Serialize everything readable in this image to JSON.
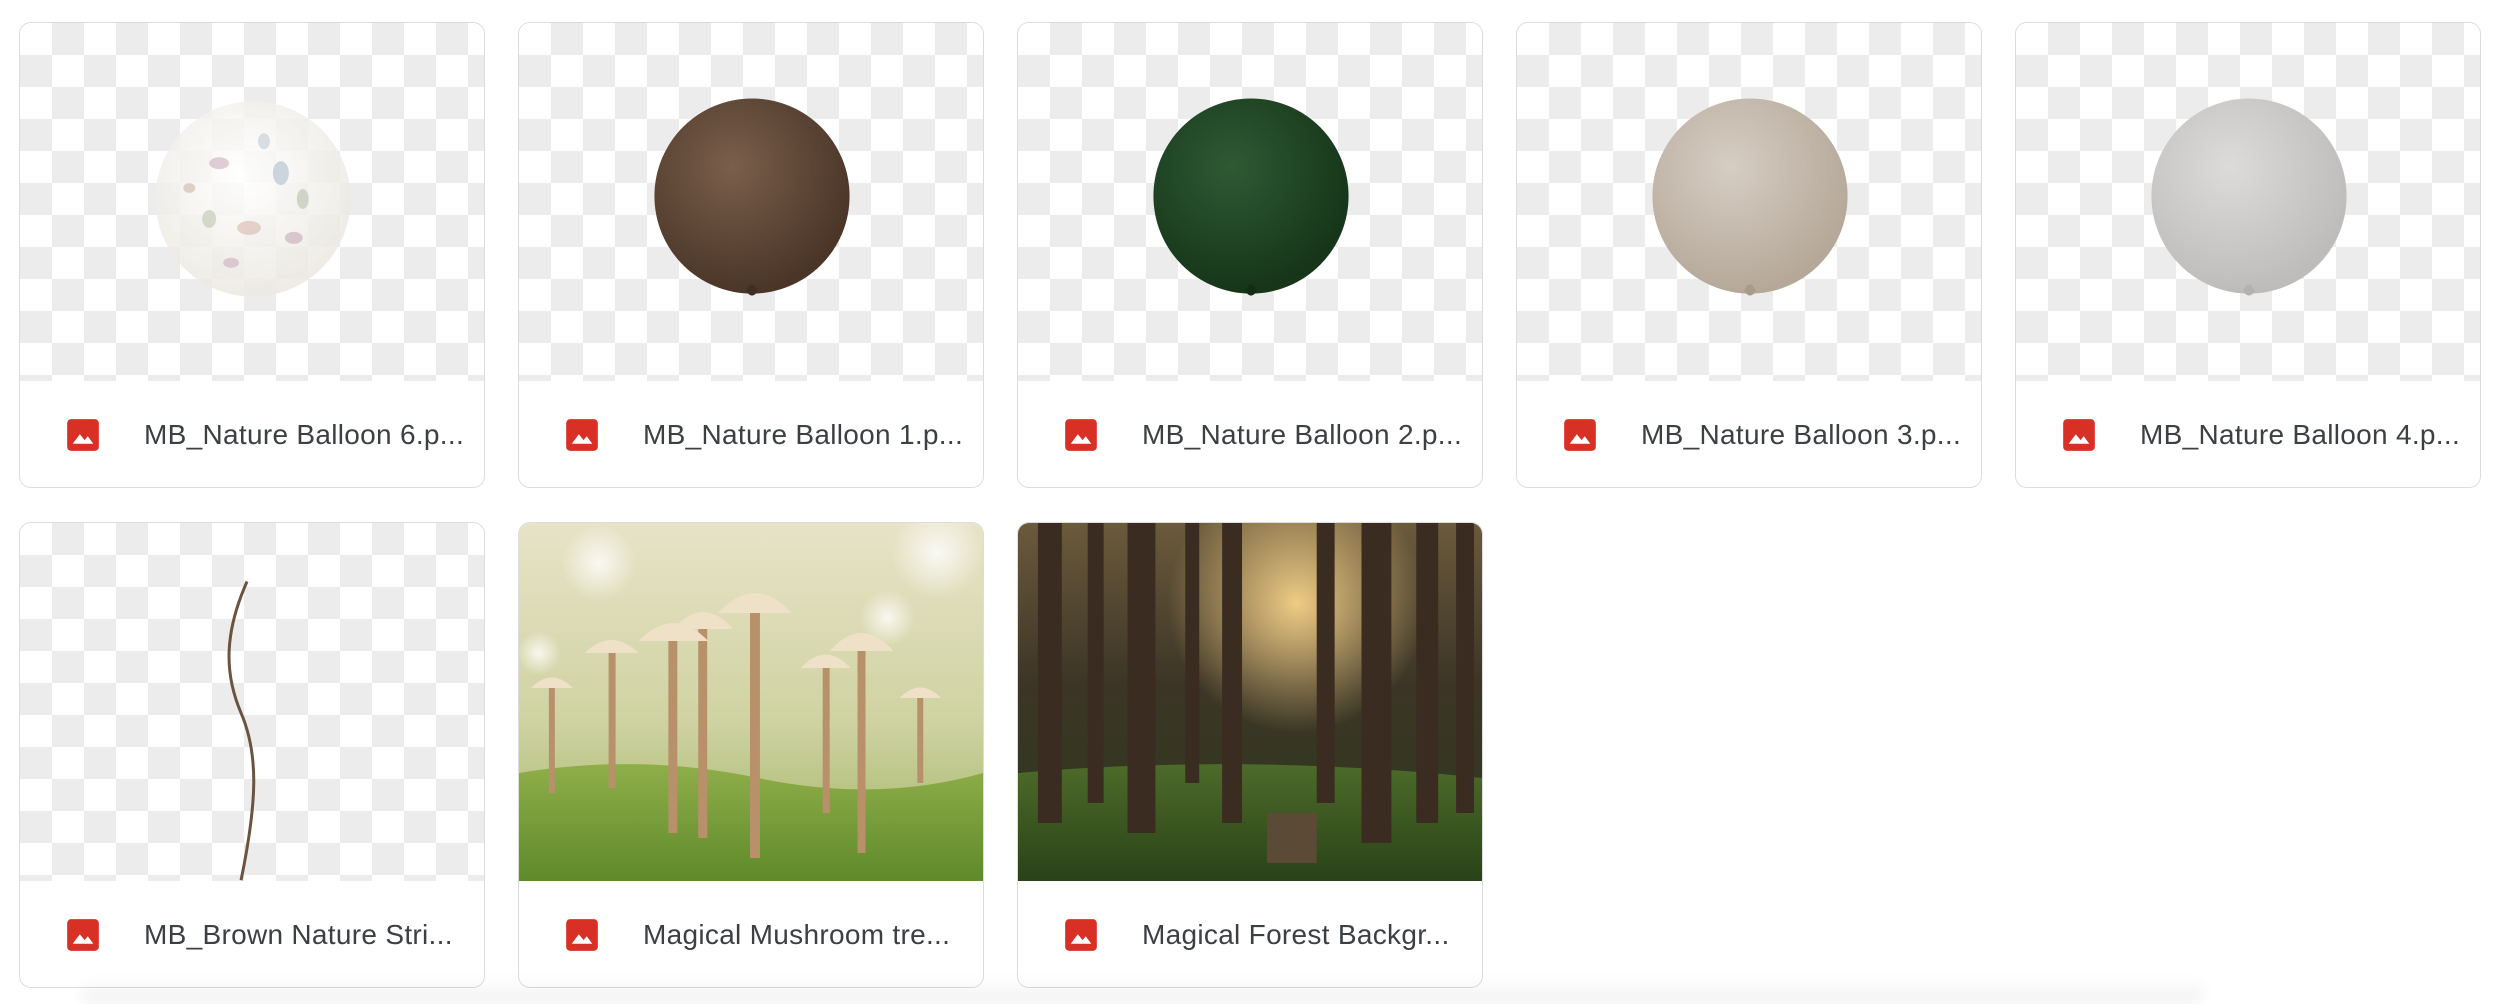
{
  "files": [
    {
      "name": "MB_Nature Balloon 6.p...",
      "type": "image",
      "thumb": "floral-balloon-icon",
      "color": "#f2f0ea"
    },
    {
      "name": "MB_Nature Balloon 1.p...",
      "type": "image",
      "thumb": "balloon-icon",
      "color": "#5b4434"
    },
    {
      "name": "MB_Nature Balloon 2.p...",
      "type": "image",
      "thumb": "balloon-icon",
      "color": "#1d4322"
    },
    {
      "name": "MB_Nature Balloon 3.p...",
      "type": "image",
      "thumb": "balloon-icon",
      "color": "#c7bbb0"
    },
    {
      "name": "MB_Nature Balloon 4.p...",
      "type": "image",
      "thumb": "balloon-icon",
      "color": "#cdcccb"
    },
    {
      "name": "MB_Brown Nature Stri...",
      "type": "image",
      "thumb": "string-icon",
      "color": "#6b5340"
    },
    {
      "name": "Magical Mushroom tre...",
      "type": "image",
      "thumb": "mushroom-photo",
      "color": "#9cb15e"
    },
    {
      "name": "Magical Forest Backgr...",
      "type": "image",
      "thumb": "forest-photo",
      "color": "#2c2a1c"
    }
  ],
  "file_type_icon": "image-file-icon",
  "accent_color": "#d93025"
}
